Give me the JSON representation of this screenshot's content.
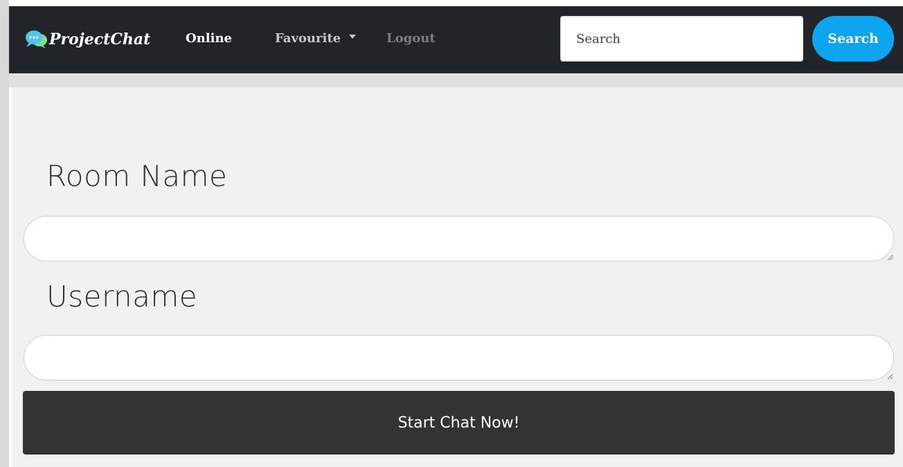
{
  "navbar": {
    "brand": "ProjectChat",
    "links": {
      "online": "Online",
      "favourite": "Favourite",
      "logout": "Logout"
    },
    "search": {
      "placeholder": "Search",
      "button_label": "Search"
    }
  },
  "form": {
    "room_label": "Room Name",
    "username_label": "Username",
    "room_value": "",
    "username_value": "",
    "submit_label": "Start Chat Now!"
  },
  "colors": {
    "navbar_bg": "#212429",
    "search_button": "#0ea5f0",
    "start_button": "#333333",
    "panel_bg": "#f1f1f1"
  },
  "icons": {
    "brand_logo": "chat-bubbles-icon",
    "favourite_dropdown": "caret-down-icon"
  }
}
